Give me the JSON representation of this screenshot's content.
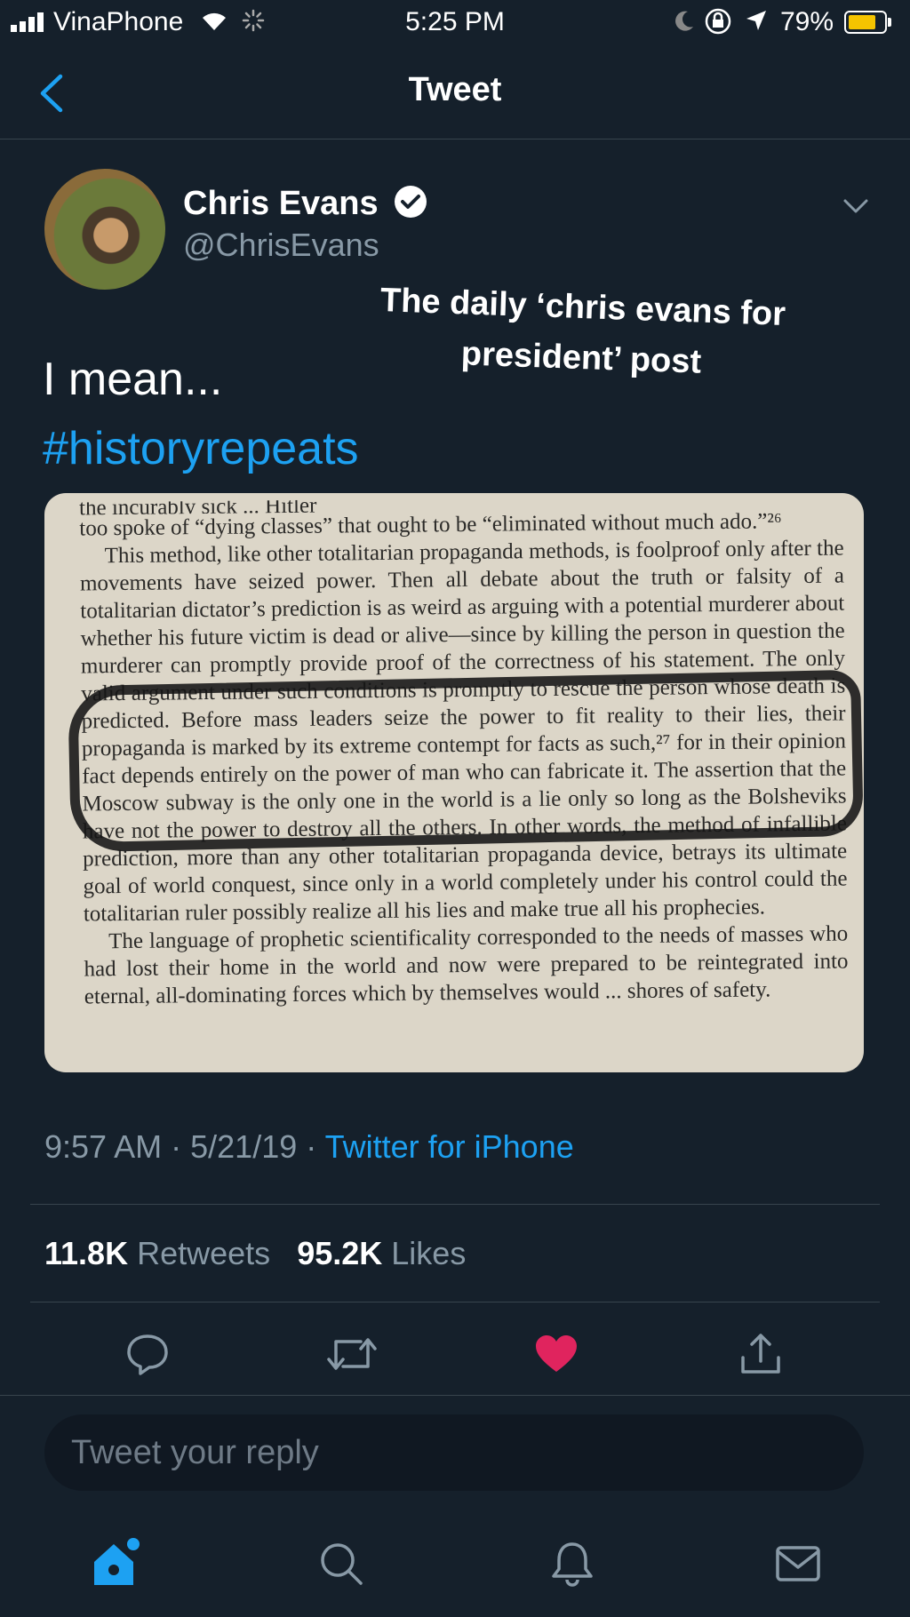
{
  "status_bar": {
    "carrier": "VinaPhone",
    "time": "5:25 PM",
    "battery_percent": "79%",
    "battery_level": 0.79,
    "battery_color": "#f5c400"
  },
  "nav": {
    "title": "Tweet",
    "back_icon": "chevron-left-icon"
  },
  "tweet": {
    "author_name": "Chris Evans",
    "author_handle": "@ChrisEvans",
    "verified": true,
    "overlay_caption_line1": "The daily ‘chris evans for",
    "overlay_caption_line2": "president’ post",
    "text": "I mean...",
    "hashtag": "#historyrepeats",
    "image_text": {
      "line0": "the incurably sick ... Hitler",
      "p1": "too spoke of “dying classes” that ought to be “eliminated without much ado.”²⁶",
      "p2": "This method, like other totalitarian propaganda methods, is foolproof only after the movements have seized power. Then all debate about the truth or falsity of a totalitarian dictator’s prediction is as weird as arguing with a potential murderer about whether his future victim is dead or alive—since by killing the person in question the murderer can promptly provide proof of the correctness of his statement. The only valid argument under such conditions is promptly to rescue the person whose death is predicted. Before mass leaders seize the power to fit reality to their lies, their propaganda is marked by its extreme contempt for facts as such,²⁷ for in their opinion fact depends entirely on the power of man who can fabricate it. The assertion that the Moscow subway is the only one in the world is a lie only so long as the Bolsheviks have not the power to destroy all the others. In other words, the method of infallible prediction, more than any other totalitarian propaganda device, betrays its ultimate goal of world conquest, since only in a world completely under his control could the totalitarian ruler possibly realize all his lies and make true all his prophecies.",
      "p3": "The language of prophetic scientificality corresponded to the needs of masses who had lost their home in the world and now were prepared to be reintegrated into eternal, all-dominating forces which by themselves would ... shores of safety."
    },
    "time": "9:57 AM",
    "date": "5/21/19",
    "separator": "·",
    "source": "Twitter for iPhone",
    "retweets_count": "11.8K",
    "retweets_label": "Retweets",
    "likes_count": "95.2K",
    "likes_label": "Likes",
    "liked": true,
    "like_color": "#e0245e",
    "accent_color": "#1da1f2"
  },
  "actions": [
    "reply-icon",
    "retweet-icon",
    "like-icon",
    "share-icon"
  ],
  "reply_box": {
    "placeholder": "Tweet your reply"
  },
  "tab_bar": {
    "items": [
      "home-icon",
      "search-icon",
      "notifications-icon",
      "messages-icon"
    ],
    "active": "home-icon"
  }
}
